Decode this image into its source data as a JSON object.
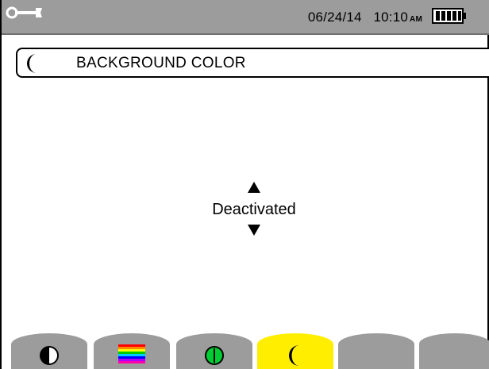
{
  "status_bar": {
    "date": "06/24/14",
    "time": "10:10",
    "ampm": "AM",
    "left_icon": "wrench-config-icon",
    "right_icon": "battery-icon"
  },
  "header": {
    "icon": "moon-icon",
    "title": "BACKGROUND COLOR"
  },
  "setting": {
    "value": "Deactivated",
    "up_icon": "arrow-up-icon",
    "down_icon": "arrow-down-icon"
  },
  "tabs": [
    {
      "icon": "contrast-icon",
      "selected": false
    },
    {
      "icon": "color-bars-icon",
      "selected": false
    },
    {
      "icon": "power-icon",
      "selected": false
    },
    {
      "icon": "moon-icon",
      "selected": true
    },
    {
      "icon": "",
      "selected": false
    },
    {
      "icon": "",
      "selected": false
    }
  ],
  "colors": {
    "status_bar": "#9c9c9c",
    "tab_default": "#9c9c9c",
    "tab_selected": "#ffee00",
    "power_green": "#00cc33"
  }
}
